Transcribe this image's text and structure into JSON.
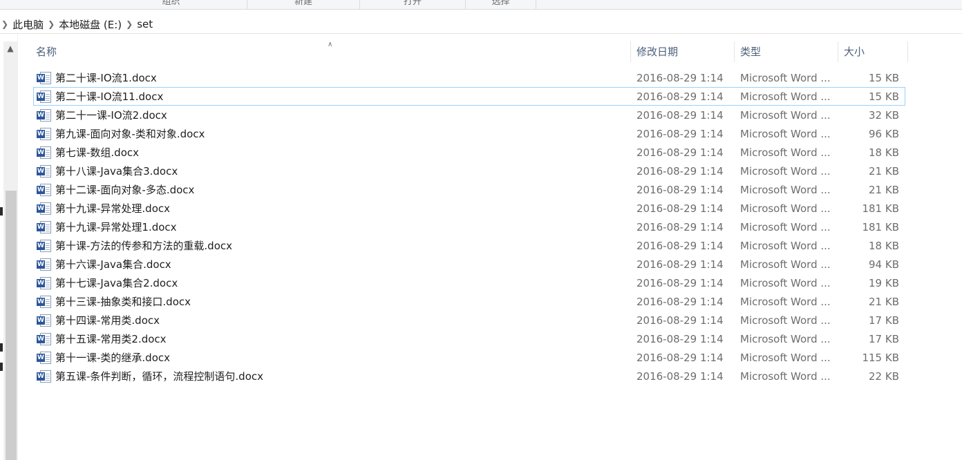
{
  "ribbon": {
    "groups": [
      "组织",
      "新建",
      "打开",
      "选择"
    ]
  },
  "address": {
    "crumbs": [
      "此电脑",
      "本地磁盘 (E:)",
      "set"
    ]
  },
  "columns": {
    "name": "名称",
    "date": "修改日期",
    "type": "类型",
    "size": "大小"
  },
  "files": [
    {
      "name": "第二十课-IO流1.docx",
      "date": "2016-08-29 1:14",
      "type": "Microsoft Word ...",
      "size": "15 KB"
    },
    {
      "name": "第二十课-IO流11.docx",
      "date": "2016-08-29 1:14",
      "type": "Microsoft Word ...",
      "size": "15 KB"
    },
    {
      "name": "第二十一课-IO流2.docx",
      "date": "2016-08-29 1:14",
      "type": "Microsoft Word ...",
      "size": "32 KB"
    },
    {
      "name": "第九课-面向对象-类和对象.docx",
      "date": "2016-08-29 1:14",
      "type": "Microsoft Word ...",
      "size": "96 KB"
    },
    {
      "name": "第七课-数组.docx",
      "date": "2016-08-29 1:14",
      "type": "Microsoft Word ...",
      "size": "18 KB"
    },
    {
      "name": "第十八课-Java集合3.docx",
      "date": "2016-08-29 1:14",
      "type": "Microsoft Word ...",
      "size": "21 KB"
    },
    {
      "name": "第十二课-面向对象-多态.docx",
      "date": "2016-08-29 1:14",
      "type": "Microsoft Word ...",
      "size": "21 KB"
    },
    {
      "name": "第十九课-异常处理.docx",
      "date": "2016-08-29 1:14",
      "type": "Microsoft Word ...",
      "size": "181 KB"
    },
    {
      "name": "第十九课-异常处理1.docx",
      "date": "2016-08-29 1:14",
      "type": "Microsoft Word ...",
      "size": "181 KB"
    },
    {
      "name": "第十课-方法的传参和方法的重载.docx",
      "date": "2016-08-29 1:14",
      "type": "Microsoft Word ...",
      "size": "18 KB"
    },
    {
      "name": "第十六课-Java集合.docx",
      "date": "2016-08-29 1:14",
      "type": "Microsoft Word ...",
      "size": "94 KB"
    },
    {
      "name": "第十七课-Java集合2.docx",
      "date": "2016-08-29 1:14",
      "type": "Microsoft Word ...",
      "size": "19 KB"
    },
    {
      "name": "第十三课-抽象类和接口.docx",
      "date": "2016-08-29 1:14",
      "type": "Microsoft Word ...",
      "size": "21 KB"
    },
    {
      "name": "第十四课-常用类.docx",
      "date": "2016-08-29 1:14",
      "type": "Microsoft Word ...",
      "size": "17 KB"
    },
    {
      "name": "第十五课-常用类2.docx",
      "date": "2016-08-29 1:14",
      "type": "Microsoft Word ...",
      "size": "17 KB"
    },
    {
      "name": "第十一课-类的继承.docx",
      "date": "2016-08-29 1:14",
      "type": "Microsoft Word ...",
      "size": "115 KB"
    },
    {
      "name": "第五课-条件判断，循环，流程控制语句.docx",
      "date": "2016-08-29 1:14",
      "type": "Microsoft Word ...",
      "size": "22 KB"
    }
  ],
  "selected_index": 1,
  "icons": {
    "file": "word-document-icon",
    "chevron": "chevron-right-icon",
    "sort": "sort-ascending-icon",
    "scroll_up": "scroll-up-arrow-icon"
  },
  "colors": {
    "selection_border": "#99d1ff",
    "word_blue": "#2b579a",
    "header_text": "#4c607a"
  }
}
